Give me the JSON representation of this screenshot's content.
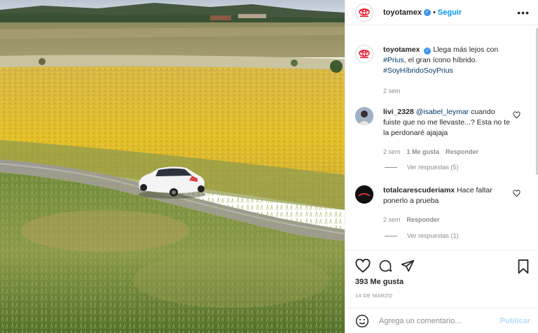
{
  "post": {
    "username": "toyotamex",
    "follow_label": "Seguir",
    "more_label": "•••",
    "dot": "•",
    "caption": {
      "text_prefix": "Llega más lejos con",
      "mention": "#Prius",
      "text_suffix": ", el gran ícono híbrido.",
      "hashtag": "#SoyHíbridoSoyPrius",
      "time": "2 sem"
    },
    "comments": [
      {
        "username": "livi_2328",
        "mention": "@isabel_leymar",
        "text": " cuando fuiste que no me llevaste...? Esta no te la perdonaré ajajaja",
        "time": "2 sem",
        "likes": "1 Me gusta",
        "reply": "Responder",
        "view_replies": "Ver respuestas (5)"
      },
      {
        "username": "totalcarescuderiamx",
        "text": " Hace faltar ponerlo a prueba",
        "time": "2 sem",
        "reply": "Responder",
        "view_replies": "Ver respuestas (1)"
      }
    ],
    "likes": "393 Me gusta",
    "date": "14 DE MARZO",
    "comment_placeholder": "Agrega un comentario...",
    "publish_label": "Publicar"
  },
  "colors": {
    "accent": "#0095f6",
    "brand_red": "#eb0a1e",
    "verified": "#3897f0"
  },
  "icons": [
    "toyota-logo-icon",
    "verified-icon",
    "more-icon",
    "heart-icon",
    "comment-icon",
    "share-icon",
    "bookmark-icon",
    "emoji-icon"
  ]
}
